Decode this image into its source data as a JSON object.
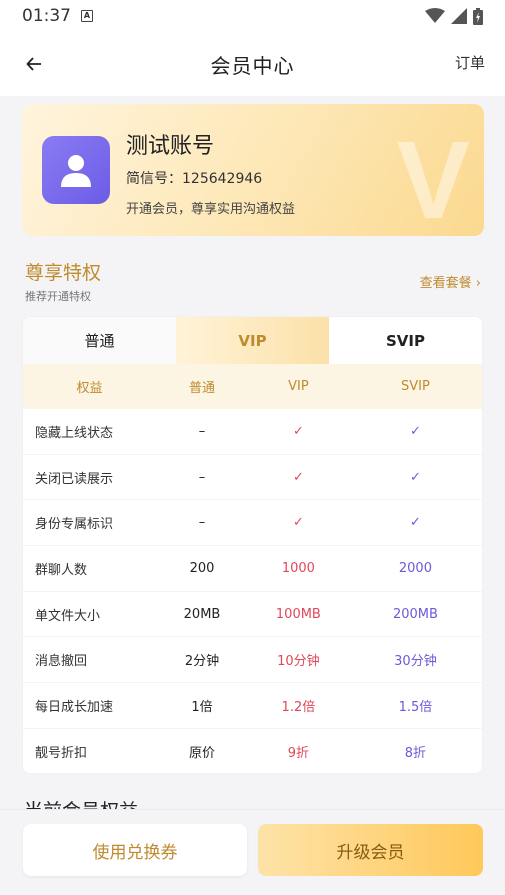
{
  "status_bar": {
    "time": "01:37",
    "badge": "A"
  },
  "header": {
    "title": "会员中心",
    "orders_label": "订单"
  },
  "vip_card": {
    "name": "测试账号",
    "jianxin_id": "简信号：125642946",
    "description": "开通会员，尊享实用沟通权益",
    "watermark": "V"
  },
  "privileges": {
    "title": "尊享特权",
    "subtitle": "推荐开通特权",
    "view_plans": "查看套餐 ›"
  },
  "tabs": [
    {
      "label": "普通"
    },
    {
      "label": "VIP"
    },
    {
      "label": "SVIP"
    }
  ],
  "table": {
    "headers": [
      "权益",
      "普通",
      "VIP",
      "SVIP"
    ],
    "rows": [
      [
        "隐藏上线状态",
        "–",
        "✓",
        "✓"
      ],
      [
        "关闭已读展示",
        "–",
        "✓",
        "✓"
      ],
      [
        "身份专属标识",
        "–",
        "✓",
        "✓"
      ],
      [
        "群聊人数",
        "200",
        "1000",
        "2000"
      ],
      [
        "单文件大小",
        "20MB",
        "100MB",
        "200MB"
      ],
      [
        "消息撤回",
        "2分钟",
        "10分钟",
        "30分钟"
      ],
      [
        "每日成长加速",
        "1倍",
        "1.2倍",
        "1.5倍"
      ],
      [
        "靓号折扣",
        "原价",
        "9折",
        "8折"
      ]
    ]
  },
  "current_benefits_title": "当前会员权益",
  "buttons": {
    "coupon": "使用兑换券",
    "upgrade": "升级会员"
  },
  "colors": {
    "gold": "#c08a2e",
    "vip_red": "#e0485a",
    "svip_purple": "#6b5bd8"
  }
}
